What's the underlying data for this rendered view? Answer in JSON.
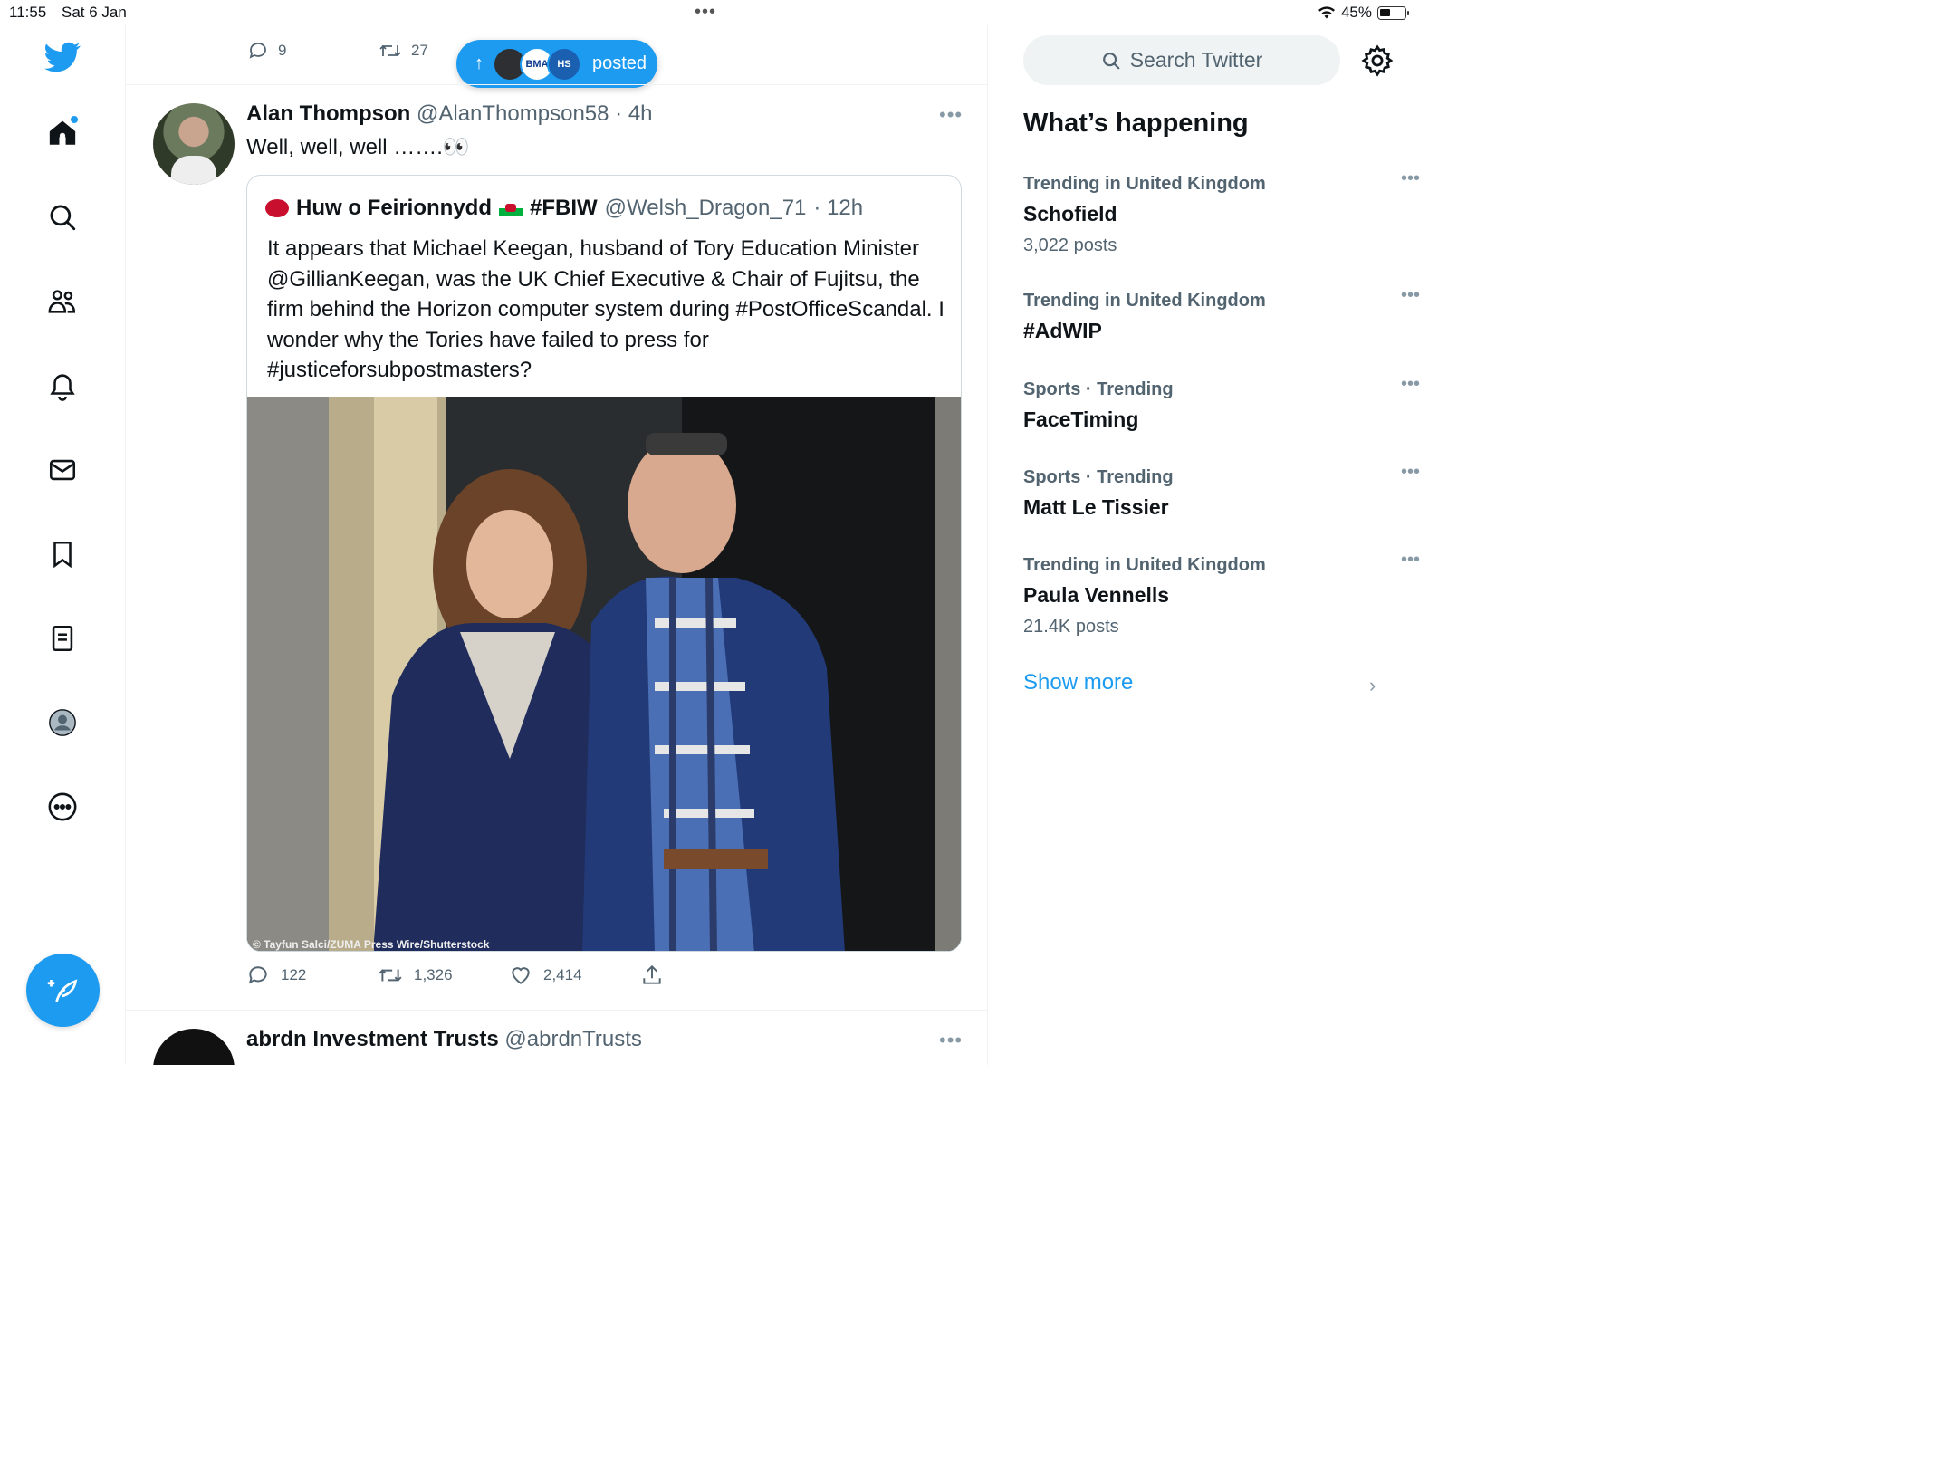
{
  "status_bar": {
    "time": "11:55",
    "date": "Sat 6 Jan",
    "battery": "45%",
    "battery_level": 0.45
  },
  "prev_tweet": {
    "replies": "9",
    "retweets": "27"
  },
  "posted_pill": {
    "label": "posted",
    "avatar_badges": [
      "BMA",
      "HS"
    ]
  },
  "tweet": {
    "name": "Alan Thompson",
    "handle": "@AlanThompson58",
    "time": "· 4h",
    "text": "Well, well, well …….👀",
    "quote": {
      "name": "Huw o Feirionnydd",
      "hashtag_name": "#FBIW",
      "handle": "@Welsh_Dragon_71",
      "time": "· 12h",
      "text": "It appears that Michael Keegan, husband of Tory Education Minister @GillianKeegan, was the UK Chief Executive & Chair of Fujitsu, the firm behind the Horizon computer system during #PostOfficeScandal. I wonder why the Tories have failed to press for #justiceforsubpostmasters?",
      "photo_credit": "© Tayfun Salci/ZUMA Press Wire/Shutterstock"
    },
    "replies": "122",
    "retweets": "1,326",
    "likes": "2,414"
  },
  "next_tweet": {
    "name": "abrdn Investment Trusts",
    "handle": "@abrdnTrusts"
  },
  "sidebar": {
    "search_placeholder": "Search Twitter",
    "heading": "What’s happening",
    "trends": [
      {
        "context": "Trending in United Kingdom",
        "title": "Schofield",
        "posts": "3,022 posts"
      },
      {
        "context": "Trending in United Kingdom",
        "title": "#AdWIP",
        "posts": ""
      },
      {
        "context": "Sports · Trending",
        "title": "FaceTiming",
        "posts": ""
      },
      {
        "context": "Sports · Trending",
        "title": "Matt Le Tissier",
        "posts": ""
      },
      {
        "context": "Trending in United Kingdom",
        "title": "Paula Vennells",
        "posts": "21.4K posts"
      }
    ],
    "show_more": "Show more"
  },
  "colors": {
    "accent": "#1d9bf0",
    "text": "#0f1419",
    "secondary": "#536471"
  },
  "icons": [
    "twitter-logo-icon",
    "home-icon",
    "search-icon",
    "communities-icon",
    "notifications-icon",
    "messages-icon",
    "bookmarks-icon",
    "lists-icon",
    "profile-icon",
    "more-icon",
    "compose-icon",
    "reply-icon",
    "retweet-icon",
    "like-icon",
    "share-icon",
    "gear-icon",
    "chevron-right-icon",
    "wifi-icon",
    "battery-icon"
  ]
}
